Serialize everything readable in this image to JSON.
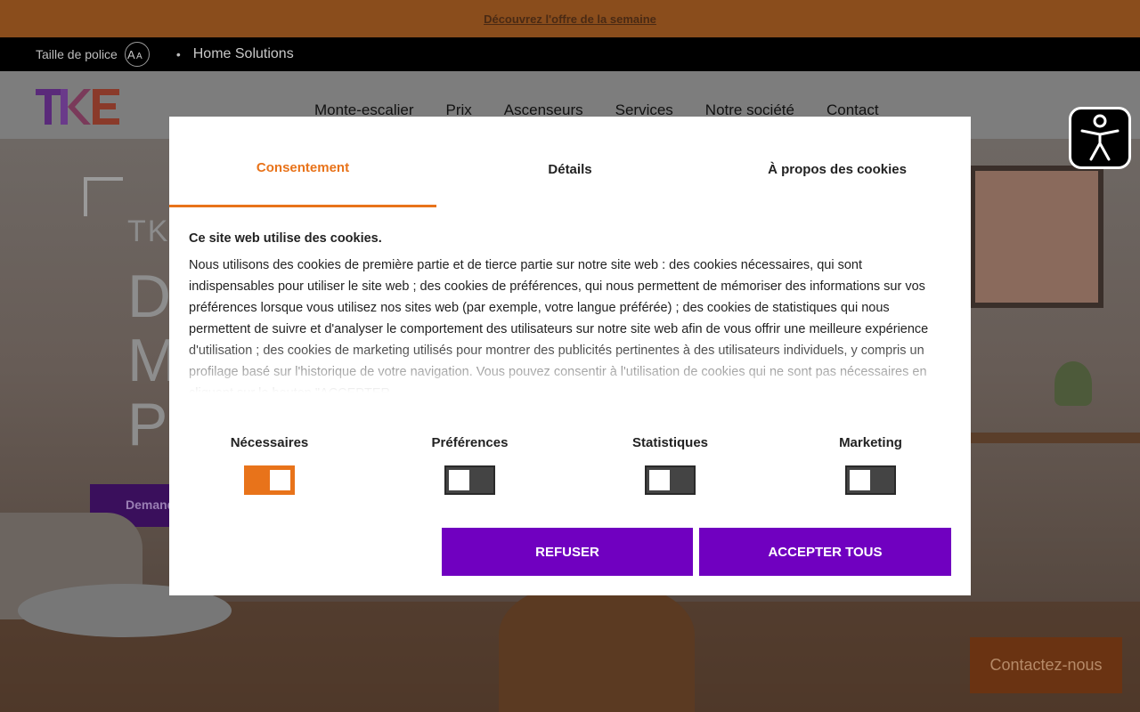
{
  "promo": {
    "text": "Découvrez l'offre de la semaine"
  },
  "utility": {
    "font_size_label": "Taille de police",
    "aa": "AA",
    "home_solutions": "Home Solutions"
  },
  "nav": {
    "items": [
      "Monte-escalier",
      "Prix",
      "Ascenseurs",
      "Services",
      "Notre société",
      "Contact"
    ]
  },
  "hero": {
    "brand": "TK",
    "line1": "D",
    "line2": "M",
    "line3": "P",
    "cta": "Demand"
  },
  "contact_button": "Contactez-nous",
  "cookie": {
    "tabs": [
      "Consentement",
      "Détails",
      "À propos des cookies"
    ],
    "active_tab": 0,
    "heading": "Ce site web utilise des cookies.",
    "body": "Nous utilisons des cookies de première partie et de tierce partie sur notre site web : des cookies nécessaires, qui sont indispensables pour utiliser le site web ; des cookies de préférences, qui nous permettent de mémoriser des informations sur vos préférences lorsque vous utilisez nos sites web (par exemple, votre langue préférée) ; des cookies de statistiques qui nous permettent de suivre et d'analyser le comportement des utilisateurs sur notre site web afin de vous offrir une meilleure expérience d'utilisation ; des cookies de marketing utilisés pour montrer des publicités pertinentes à des utilisateurs individuels, y compris un profilage basé sur l'historique de votre navigation. Vous pouvez consentir à l'utilisation de cookies qui ne sont pas nécessaires en cliquant sur le bouton \"ACCEPTER",
    "toggles": [
      {
        "label": "Nécessaires",
        "on": true
      },
      {
        "label": "Préférences",
        "on": false
      },
      {
        "label": "Statistiques",
        "on": false
      },
      {
        "label": "Marketing",
        "on": false
      }
    ],
    "refuse": "REFUSER",
    "accept": "ACCEPTER TOUS"
  },
  "colors": {
    "accent_orange": "#e8731a",
    "button_purple": "#7000c0"
  },
  "icons": {
    "accessibility": "accessibility-icon",
    "font_size": "aa-icon"
  }
}
